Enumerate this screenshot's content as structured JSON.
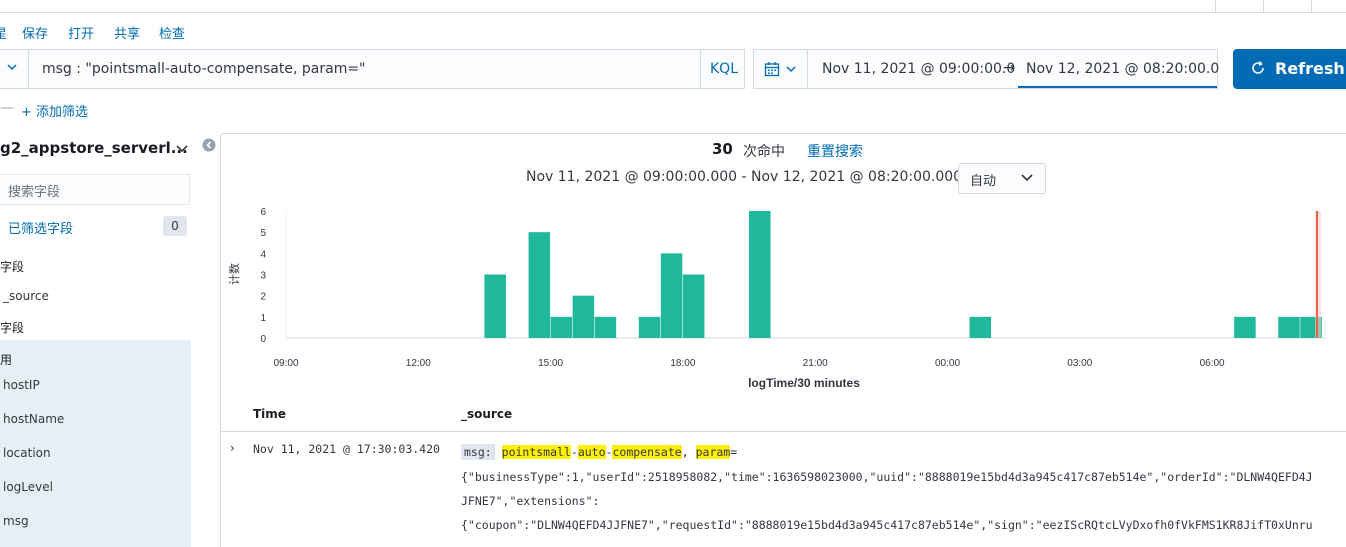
{
  "menu": {
    "partial_first": "星",
    "save": "保存",
    "open": "打开",
    "share": "共享",
    "inspect": "检查"
  },
  "query": {
    "text": "msg : \"pointsmall-auto-compensate, param=\"",
    "language": "KQL"
  },
  "date_picker": {
    "start": "Nov 11, 2021 @ 09:00:00.0",
    "arrow": "→",
    "end": "Nov 12, 2021 @ 08:20:00.0"
  },
  "refresh": {
    "label": "Refresh"
  },
  "filters": {
    "dash": "—",
    "add_label": "+ 添加筛选"
  },
  "sidebar": {
    "index_name": "g2_appstore_serverl...",
    "search_placeholder": "搜索字段",
    "filtered_label": "已筛选字段",
    "filtered_count": "0",
    "selected_head": "字段",
    "selected_fields": [
      "_source"
    ],
    "available_head": "字段",
    "popular_head": "用",
    "popular_fields": [
      "hostIP",
      "hostName",
      "location",
      "logLevel",
      "msg"
    ]
  },
  "summary": {
    "hits": "30",
    "hits_label": "次命中",
    "reset": "重置搜索",
    "range": "Nov 11, 2021 @ 09:00:00.000 - Nov 12, 2021 @ 08:20:00.000 —",
    "interval": "自动"
  },
  "chart_data": {
    "type": "bar",
    "xlabel": "logTime/30 minutes",
    "ylabel": "计数",
    "ylim": [
      0,
      6
    ],
    "yticks": [
      "0",
      "1",
      "2",
      "3",
      "4",
      "5",
      "6"
    ],
    "xticks": [
      "09:00",
      "12:00",
      "15:00",
      "18:00",
      "21:00",
      "00:00",
      "03:00",
      "06:00"
    ],
    "bar_color": "#1fb89a",
    "marker_color": "#e7664c",
    "series": [
      {
        "x": [
          "13:30",
          "14:30",
          "15:00",
          "15:30",
          "16:00",
          "17:00",
          "17:30",
          "18:00",
          "19:30",
          "00:30",
          "06:30",
          "07:30",
          "08:00"
        ],
        "values": [
          3,
          5,
          1,
          2,
          1,
          1,
          4,
          3,
          6,
          1,
          1,
          1,
          1
        ]
      }
    ]
  },
  "table": {
    "col_time": "Time",
    "col_source": "_source",
    "rows": [
      {
        "time": "Nov 11, 2021 @ 17:30:03.420",
        "msg_key": "msg:",
        "hl1": "pointsmall",
        "d1": "-",
        "hl2": "auto",
        "d2": "-",
        "hl3": "compensate",
        "comma": ",",
        "hl4": "param",
        "eq": "=",
        "line2": "{\"businessType\":1,\"userId\":2518958082,\"time\":1636598023000,\"uuid\":\"8888019e15bd4d3a945c417c87eb514e\",\"orderId\":\"DLNW4QEFD4J",
        "line3": "JFNE7\",\"extensions\":",
        "line4": "{\"coupon\":\"DLNW4QEFD4JJFNE7\",\"requestId\":\"8888019e15bd4d3a945c417c87eb514e\",\"sign\":\"eezIScRQtcLVyDxofh0fVkFMS1KR8JifT0xUnru"
      }
    ]
  }
}
